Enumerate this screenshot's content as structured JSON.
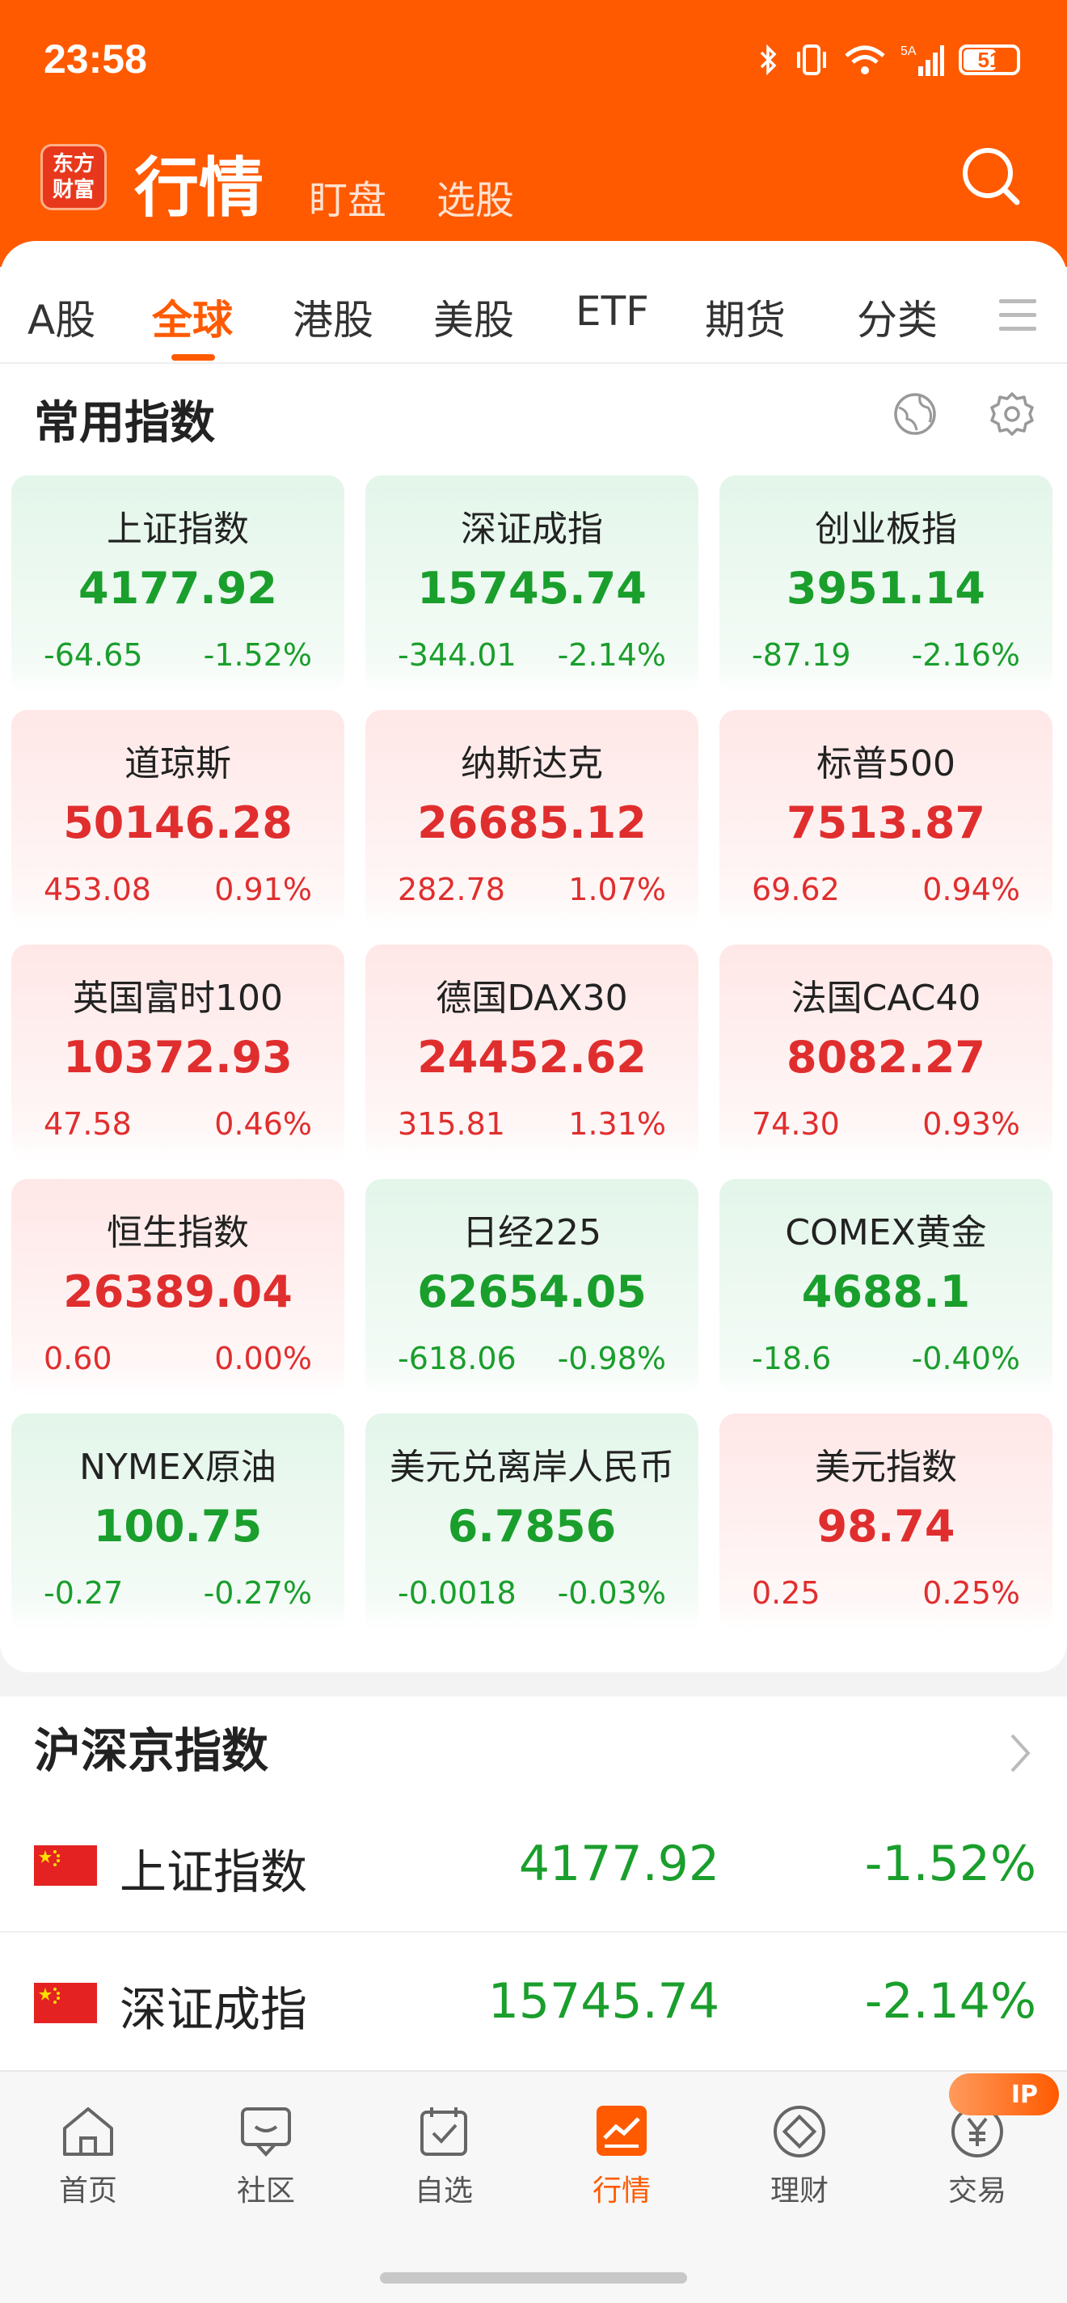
{
  "status_bar": {
    "time": "23:58",
    "battery": "51"
  },
  "header": {
    "logo_line1": "东方",
    "logo_line2": "财富",
    "title": "行情",
    "sub_tabs": [
      "盯盘",
      "选股"
    ]
  },
  "tabs": [
    "A股",
    "全球",
    "港股",
    "美股",
    "ETF",
    "期货",
    "分类"
  ],
  "active_tab": "全球",
  "common_indices": {
    "title": "常用指数",
    "cards": [
      {
        "name": "上证指数",
        "price": "4177.92",
        "change": "-64.65",
        "pct": "-1.52%",
        "trend": "down"
      },
      {
        "name": "深证成指",
        "price": "15745.74",
        "change": "-344.01",
        "pct": "-2.14%",
        "trend": "down"
      },
      {
        "name": "创业板指",
        "price": "3951.14",
        "change": "-87.19",
        "pct": "-2.16%",
        "trend": "down"
      },
      {
        "name": "道琼斯",
        "price": "50146.28",
        "change": "453.08",
        "pct": "0.91%",
        "trend": "up"
      },
      {
        "name": "纳斯达克",
        "price": "26685.12",
        "change": "282.78",
        "pct": "1.07%",
        "trend": "up"
      },
      {
        "name": "标普500",
        "price": "7513.87",
        "change": "69.62",
        "pct": "0.94%",
        "trend": "up"
      },
      {
        "name": "英国富时100",
        "price": "10372.93",
        "change": "47.58",
        "pct": "0.46%",
        "trend": "up"
      },
      {
        "name": "德国DAX30",
        "price": "24452.62",
        "change": "315.81",
        "pct": "1.31%",
        "trend": "up"
      },
      {
        "name": "法国CAC40",
        "price": "8082.27",
        "change": "74.30",
        "pct": "0.93%",
        "trend": "up"
      },
      {
        "name": "恒生指数",
        "price": "26389.04",
        "change": "0.60",
        "pct": "0.00%",
        "trend": "up"
      },
      {
        "name": "日经225",
        "price": "62654.05",
        "change": "-618.06",
        "pct": "-0.98%",
        "trend": "down"
      },
      {
        "name": "COMEX黄金",
        "price": "4688.1",
        "change": "-18.6",
        "pct": "-0.40%",
        "trend": "down"
      },
      {
        "name": "NYMEX原油",
        "price": "100.75",
        "change": "-0.27",
        "pct": "-0.27%",
        "trend": "down"
      },
      {
        "name": "美元兑离岸人民币",
        "price": "6.7856",
        "change": "-0.0018",
        "pct": "-0.03%",
        "trend": "down"
      },
      {
        "name": "美元指数",
        "price": "98.74",
        "change": "0.25",
        "pct": "0.25%",
        "trend": "up"
      }
    ]
  },
  "hsj_section": {
    "title": "沪深京指数",
    "rows": [
      {
        "name": "上证指数",
        "price": "4177.92",
        "pct": "-1.52%"
      },
      {
        "name": "深证成指",
        "price": "15745.74",
        "pct": "-2.14%"
      }
    ]
  },
  "bottom_nav": [
    "首页",
    "社区",
    "自选",
    "行情",
    "理财",
    "交易"
  ],
  "bottom_nav_active": "行情",
  "badge_text": "IP",
  "colors": {
    "brand": "#ff5a00",
    "up": "#e02e2e",
    "down": "#1a9e2c"
  }
}
